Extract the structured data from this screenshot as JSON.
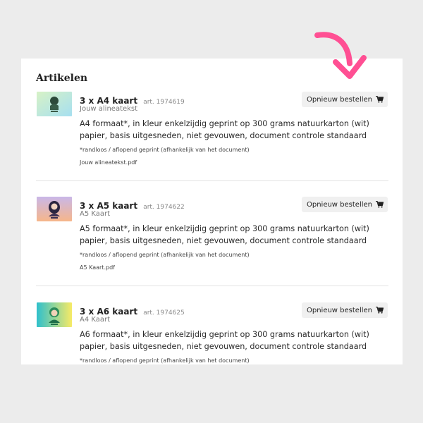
{
  "section_title": "Artikelen",
  "reorder_label": "Opnieuw bestellen",
  "items": [
    {
      "title": "3 x A4 kaart",
      "art": "art. 1974619",
      "subtitle": "Jouw alineatekst",
      "description": "A4 formaat*, in kleur enkelzijdig geprint op 300 grams natuurkarton (wit) papier, basis uitgesneden, niet gevouwen, document controle standaard",
      "note": "*randloos / aflopend geprint (afhankelijk van het document)",
      "file": "Jouw alineatekst.pdf",
      "thumb_colors": [
        "#c8ecd0",
        "#a6dff0"
      ]
    },
    {
      "title": "3 x A5 kaart",
      "art": "art. 1974622",
      "subtitle": "A5 Kaart",
      "description": "A5 formaat*, in kleur enkelzijdig geprint op 300 grams natuurkarton (wit) papier, basis uitgesneden, niet gevouwen, document controle standaard",
      "note": "*randloos / aflopend geprint (afhankelijk van het document)",
      "file": "A5 Kaart.pdf",
      "thumb_colors": [
        "#c9b7e8",
        "#f6b68a"
      ]
    },
    {
      "title": "3 x A6 kaart",
      "art": "art. 1974625",
      "subtitle": "A4 Kaart",
      "description": "A6 formaat*, in kleur enkelzijdig geprint op 300 grams natuurkarton (wit) papier, basis uitgesneden, niet gevouwen, document controle standaard",
      "note": "*randloos / aflopend geprint (afhankelijk van het document)",
      "file": "",
      "thumb_colors": [
        "#33c3c9",
        "#f5e86a"
      ]
    }
  ],
  "colors": {
    "arrow": "#ff4f93",
    "card": "#ffffff",
    "background": "#ececec"
  },
  "icons": {
    "reorder": "shopping-cart-icon",
    "annotation": "curved-arrow-icon"
  }
}
